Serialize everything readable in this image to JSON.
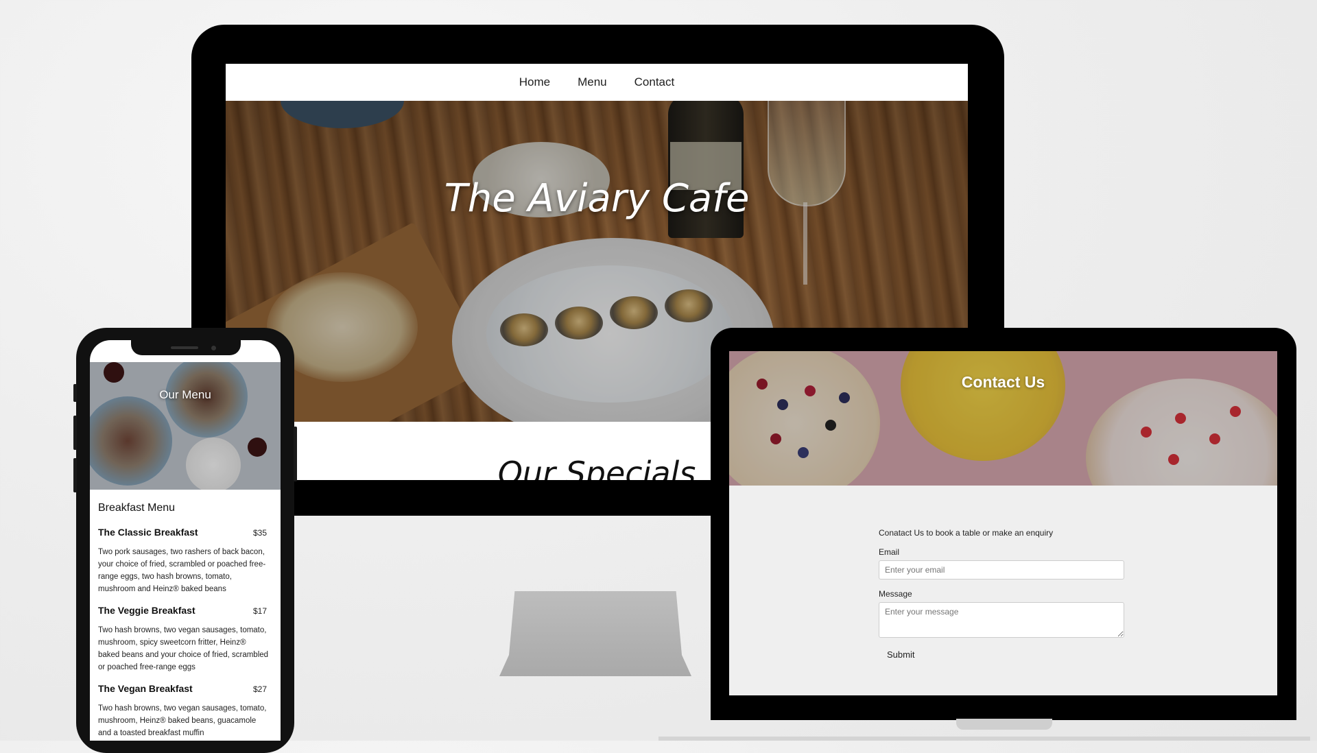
{
  "desktop": {
    "nav": [
      "Home",
      "Menu",
      "Contact"
    ],
    "hero_title": "The Aviary Cafe",
    "section_title": "Our Specials"
  },
  "laptop": {
    "hero_title": "Contact Us",
    "intro": "Conatact Us to book a table or make an enquiry",
    "email_label": "Email",
    "email_placeholder": "Enter your email",
    "message_label": "Message",
    "message_placeholder": "Enter your message",
    "submit_label": "Submit"
  },
  "phone": {
    "hero_title": "Our Menu",
    "menu_heading": "Breakfast Menu",
    "items": [
      {
        "name": "The Classic Breakfast",
        "price": "$35",
        "description": "Two pork sausages, two rashers of back bacon, your choice of fried, scrambled or poached free-range eggs, two hash browns, tomato, mushroom and Heinz® baked beans"
      },
      {
        "name": "The Veggie Breakfast",
        "price": "$17",
        "description": "Two hash browns, two vegan sausages, tomato, mushroom, spicy sweetcorn fritter, Heinz® baked beans and your choice of fried, scrambled or poached free-range eggs"
      },
      {
        "name": "The Vegan Breakfast",
        "price": "$27",
        "description": "Two hash browns, two vegan sausages, tomato, mushroom, Heinz® baked beans, guacamole and a toasted breakfast muffin"
      }
    ]
  },
  "colors": {
    "bezel": "#000000",
    "background": "#eeeeee",
    "form_background": "#efefef"
  }
}
